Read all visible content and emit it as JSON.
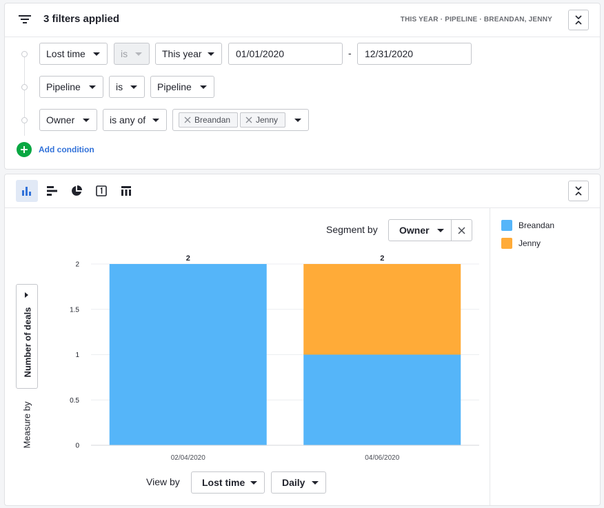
{
  "filters": {
    "title": "3 filters applied",
    "summary": "THIS YEAR  ·  PIPELINE  ·  BREANDAN, JENNY",
    "rows": [
      {
        "field": "Lost time",
        "operator": "is",
        "value": "This year",
        "date_from": "01/01/2020",
        "date_sep": "-",
        "date_to": "12/31/2020"
      },
      {
        "field": "Pipeline",
        "operator": "is",
        "value": "Pipeline"
      },
      {
        "field": "Owner",
        "operator": "is any of",
        "chips": [
          "Breandan",
          "Jenny"
        ]
      }
    ],
    "add_condition_label": "Add condition"
  },
  "report": {
    "segment_label": "Segment by",
    "segment_value": "Owner",
    "measure_label": "Measure by",
    "measure_value": "Number of deals",
    "view_by_label": "View by",
    "view_by_value": "Lost time",
    "interval_value": "Daily",
    "icons": [
      "bar-chart-icon",
      "horizontal-bar-icon",
      "pie-chart-icon",
      "scorecard-icon",
      "table-icon"
    ]
  },
  "legend": [
    {
      "name": "Breandan",
      "color": "#55b5f9"
    },
    {
      "name": "Jenny",
      "color": "#ffab38"
    }
  ],
  "chart_data": {
    "type": "bar",
    "stacked": true,
    "categories": [
      "02/04/2020",
      "04/06/2020"
    ],
    "series": [
      {
        "name": "Breandan",
        "values": [
          2,
          1
        ],
        "color": "#55b5f9"
      },
      {
        "name": "Jenny",
        "values": [
          0,
          1
        ],
        "color": "#ffab38"
      }
    ],
    "totals": [
      2,
      2
    ],
    "y_ticks": [
      "0",
      "0.5",
      "1",
      "1.5",
      "2"
    ],
    "ylim": [
      0,
      2
    ],
    "ylabel": "Number of deals",
    "grid": true,
    "legend_position": "right"
  }
}
